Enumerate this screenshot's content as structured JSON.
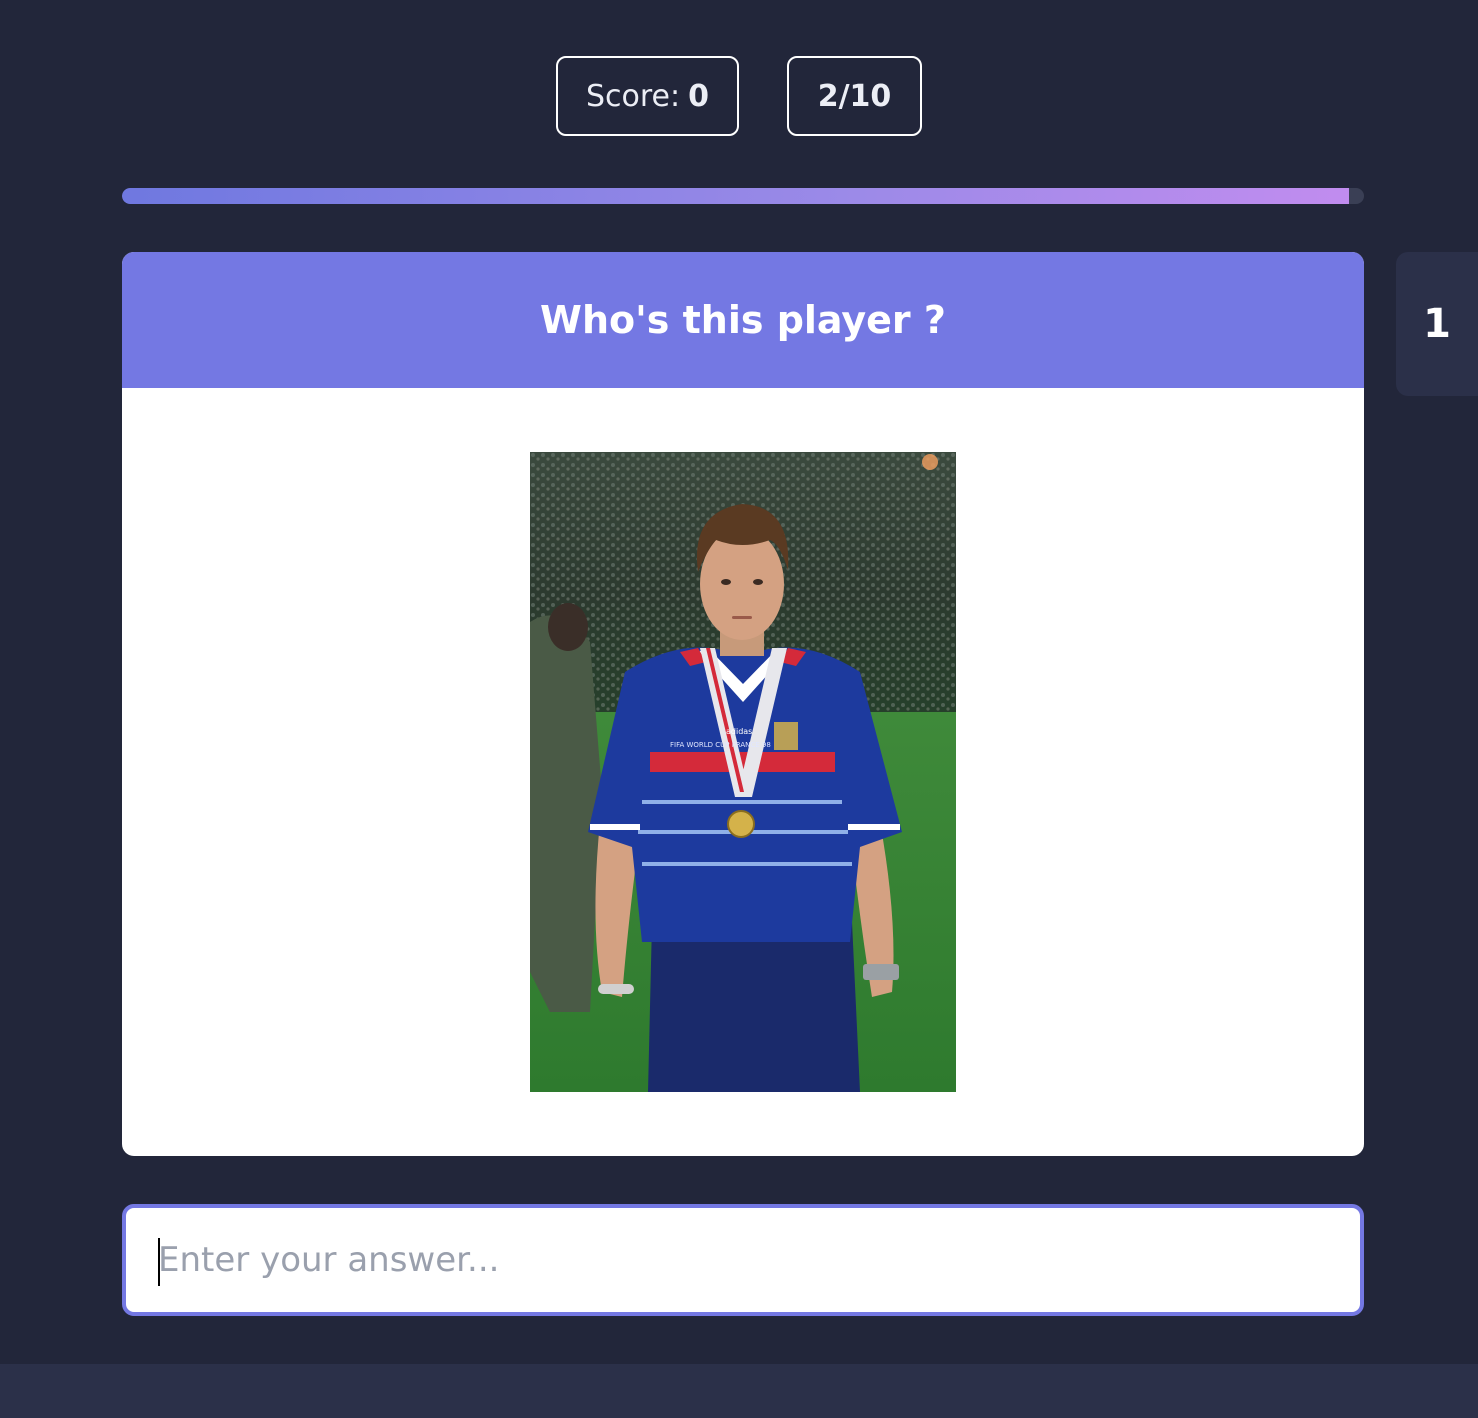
{
  "stats": {
    "score_label": "Score:",
    "score_value": "0",
    "question_counter": "2/10"
  },
  "progress": {
    "fraction": 0.988
  },
  "question": {
    "title": "Who's this player ?"
  },
  "side_tab": {
    "label": "1"
  },
  "photo": {
    "jersey_text": "FIFA WORLD CUP FRANCE 98",
    "brand_text": "adidas"
  },
  "answer": {
    "placeholder": "Enter your answer...",
    "value": ""
  },
  "colors": {
    "background": "#22263a",
    "accent": "#7478e3",
    "progress_start": "#6f78e0",
    "progress_end": "#c18cef",
    "jersey_blue": "#1d3a9e",
    "jersey_red": "#d42a3a"
  }
}
